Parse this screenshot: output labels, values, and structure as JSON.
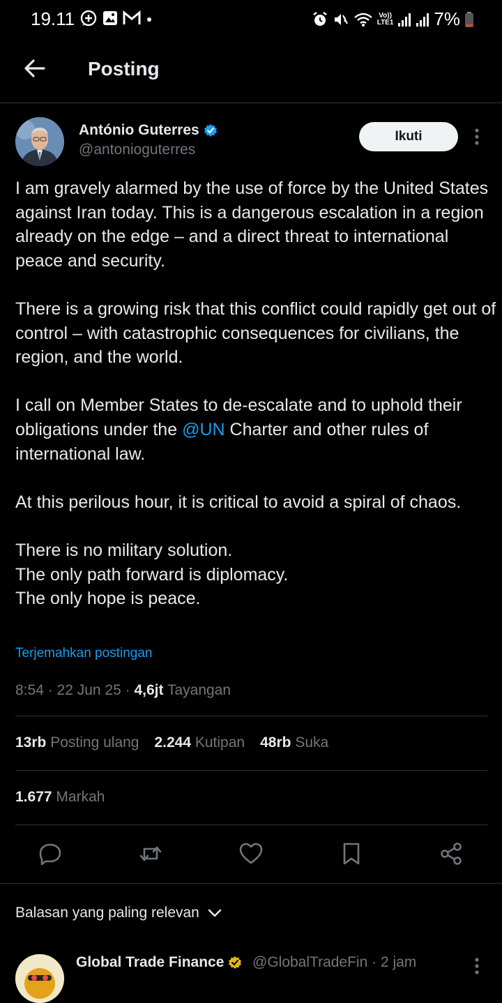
{
  "status_bar": {
    "time": "19.11",
    "battery": "7%",
    "network_label": "LTE1",
    "icons": [
      "whatsapp-status-icon",
      "gallery-icon",
      "gmail-icon",
      "dot-icon",
      "alarm-icon",
      "mute-icon",
      "wifi-icon",
      "volte-icon",
      "signal-icon",
      "signal-icon",
      "battery-icon"
    ]
  },
  "header": {
    "title": "Posting"
  },
  "post": {
    "author_name": "António Guterres",
    "author_handle": "@antonioguterres",
    "verified": true,
    "follow_label": "Ikuti",
    "paragraphs": {
      "p1": "I am gravely alarmed by the use of force by the United States against Iran today. This is a dangerous escalation in a region already on the edge – and a direct threat to international peace and security.",
      "p2": "There is a growing risk that this conflict could rapidly get out of control – with catastrophic consequences for civilians, the region, and the world.",
      "p3_before": "I call on Member States to de-escalate and to uphold their obligations under the ",
      "p3_mention": "@UN",
      "p3_after": " Charter and other rules of international law.",
      "p4": "At this perilous hour, it is critical to avoid a spiral of chaos.",
      "p5": "There is no military solution.\nThe only path forward is diplomacy.\nThe only hope is peace."
    },
    "translate_label": "Terjemahkan postingan",
    "time": "8:54",
    "date": "22 Jun 25",
    "views_count": "4,6jt",
    "views_label": "Tayangan",
    "reposts_count": "13rb",
    "reposts_label": "Posting ulang",
    "quotes_count": "2.244",
    "quotes_label": "Kutipan",
    "likes_count": "48rb",
    "likes_label": "Suka",
    "bookmarks_count": "1.677",
    "bookmarks_label": "Markah"
  },
  "replies": {
    "sort_label": "Balasan yang paling relevan",
    "first_reply": {
      "name": "Global Trade Finance",
      "handle": "@GlobalTradeFin",
      "time": "2 jam",
      "verified_color": "#e2b719"
    }
  },
  "colors": {
    "background": "#000000",
    "link": "#1d9bf0",
    "secondary_text": "#71767b",
    "primary_text": "#e7e9ea",
    "verified": "#1d9bf0"
  }
}
